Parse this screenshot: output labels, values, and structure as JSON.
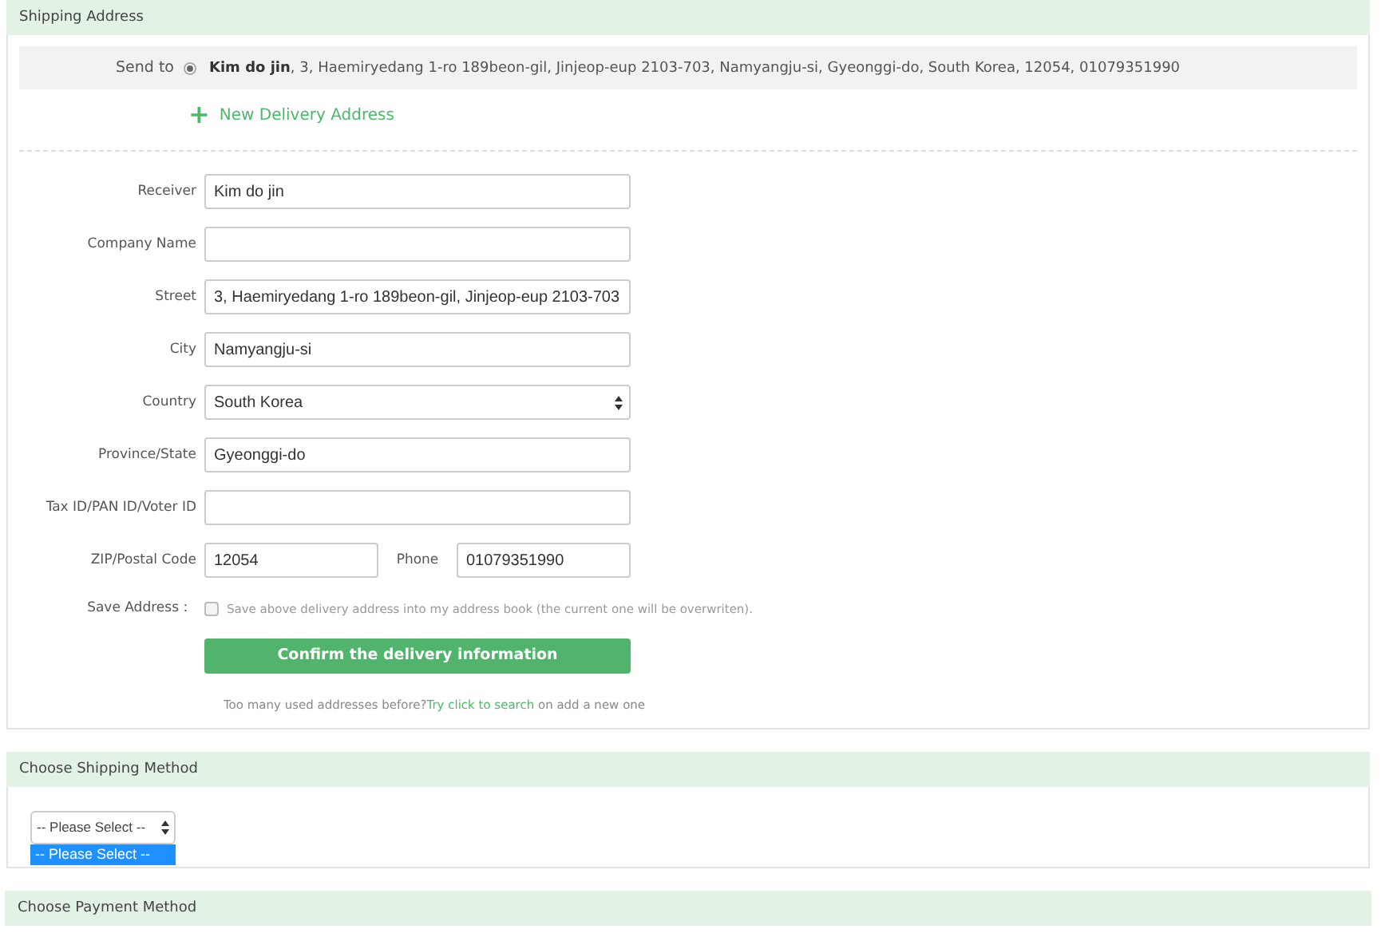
{
  "shipping_address": {
    "title": "Shipping Address",
    "send_to": {
      "label": "Send to",
      "selected": true,
      "name": "Kim do jin",
      "address": ", 3, Haemiryedang 1-ro 189beon-gil, Jinjeop-eup 2103-703, Namyangju-si, Gyeonggi-do, South Korea, 12054, 01079351990"
    },
    "new_address": {
      "icon": "+",
      "label": "New Delivery Address"
    },
    "fields": [
      {
        "kind": "text",
        "label": "Receiver",
        "value": "Kim do jin"
      },
      {
        "kind": "text",
        "label": "Company Name"
      },
      {
        "kind": "text",
        "label": "Street",
        "value": "3, Haemiryedang 1-ro 189beon-gil, Jinjeop-eup 2103-703"
      },
      {
        "kind": "text",
        "label": "City",
        "value": "Namyangju-si"
      },
      {
        "kind": "select",
        "label": "Country",
        "value": "South Korea"
      },
      {
        "kind": "text",
        "label": "Province/State",
        "value": "Gyeonggi-do"
      },
      {
        "kind": "text",
        "label": "Tax ID/PAN ID/Voter ID"
      },
      {
        "kind": "pair",
        "label": "ZIP/Postal Code",
        "value": "12054",
        "second_label": "Phone",
        "second_value": "01079351990"
      }
    ],
    "save_address": {
      "label": "Save Address：",
      "checked": false,
      "text": "Save above delivery address into my address book (the current one will be overwriten)."
    },
    "confirm_button": "Confirm the delivery information",
    "note": {
      "before": "Too many used addresses before?",
      "link": "Try click to search",
      "after": " on add a new one"
    }
  },
  "shipping_method": {
    "title": "Choose Shipping Method",
    "select": {
      "value": "-- Please Select --"
    },
    "options": [
      {
        "label": "-- Please Select --",
        "selected": true
      }
    ]
  },
  "payment_method": {
    "title": "Choose Payment Method"
  }
}
